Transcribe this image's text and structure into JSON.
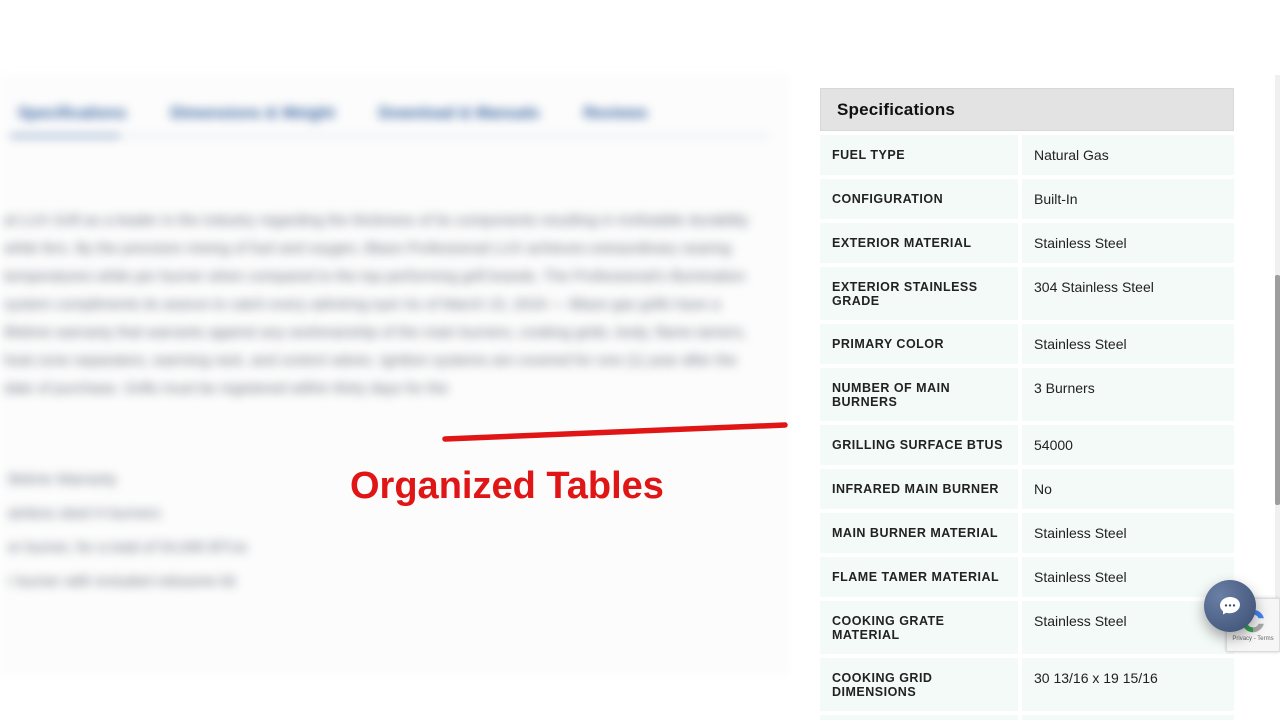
{
  "tabs": {
    "t1": "Specifications",
    "t2": "Dimensions & Weight",
    "t3": "Download & Manuals",
    "t4": "Reviews"
  },
  "paragraph": "al LUX Grill as a leader in the industry regarding the thickness of its components resulting in irrefutable durability while fers. By the precision mixing of fuel and oxygen, Blaze Professional LUX achieves extraordinary searing temperatures while per burner when compared to the top performing grill brands. The Professional's illumination system compliments its arance to catch every admiring eye! As of March 15, 2016 — Blaze gas grills have a lifetime warranty that warrants against any workmanship of the main burners, cooking grids, body, flame tamers, heat zone separators, warming rack, and control valves. Ignition systems are covered for one (1) year after the date of purchase. Grills must be registered within thirty days for the",
  "bullets": {
    "b1": "ifetime Warranty",
    "b2": "ainless steel H burners",
    "b3": "er burner, for a total of 54,000 BTUs",
    "b4": "r burner with included rotisserie kit"
  },
  "annotation": "Organized Tables",
  "panel_title": "Specifications",
  "specs": [
    {
      "k": "FUEL TYPE",
      "v": "Natural Gas"
    },
    {
      "k": "CONFIGURATION",
      "v": "Built-In"
    },
    {
      "k": "EXTERIOR MATERIAL",
      "v": "Stainless Steel"
    },
    {
      "k": "EXTERIOR STAINLESS GRADE",
      "v": "304 Stainless Steel"
    },
    {
      "k": "PRIMARY COLOR",
      "v": "Stainless Steel"
    },
    {
      "k": "NUMBER OF MAIN BURNERS",
      "v": "3 Burners"
    },
    {
      "k": "GRILLING SURFACE BTUS",
      "v": "54000"
    },
    {
      "k": "INFRARED MAIN BURNER",
      "v": "No"
    },
    {
      "k": "MAIN BURNER MATERIAL",
      "v": "Stainless Steel"
    },
    {
      "k": "FLAME TAMER MATERIAL",
      "v": "Stainless Steel"
    },
    {
      "k": "COOKING GRATE MATERIAL",
      "v": "Stainless Steel"
    },
    {
      "k": "COOKING GRID DIMENSIONS",
      "v": "30 13/16 x 19 15/16"
    }
  ],
  "recaptcha": "Privacy - Terms"
}
